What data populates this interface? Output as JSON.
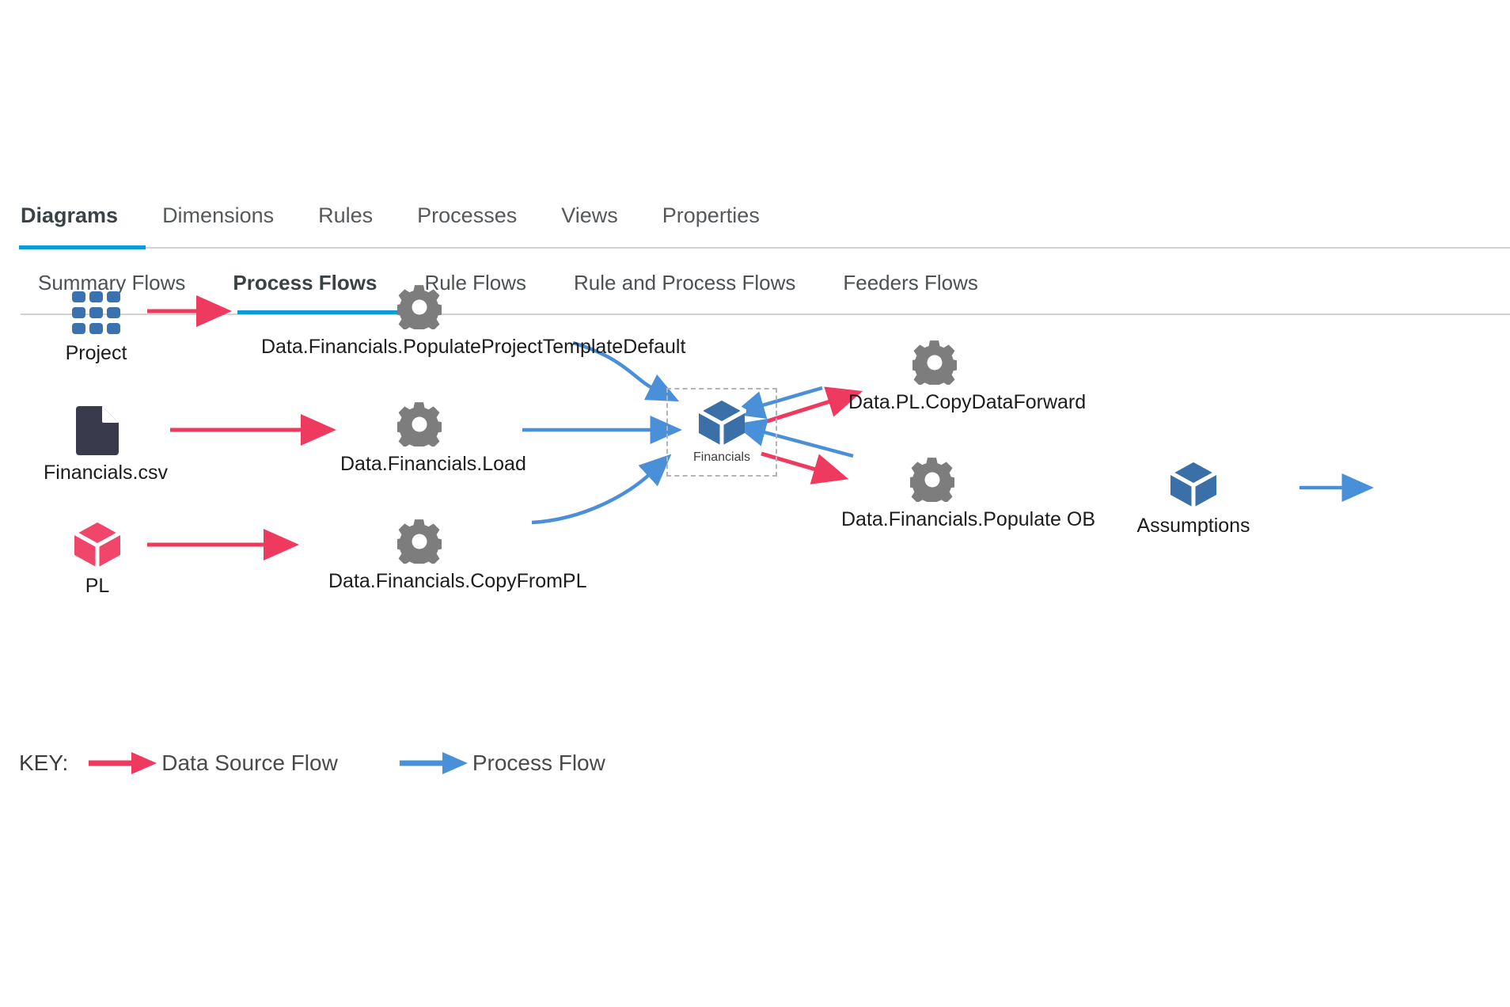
{
  "primary_tabs": [
    {
      "label": "Diagrams",
      "active": true
    },
    {
      "label": "Dimensions",
      "active": false
    },
    {
      "label": "Rules",
      "active": false
    },
    {
      "label": "Processes",
      "active": false
    },
    {
      "label": "Views",
      "active": false
    },
    {
      "label": "Properties",
      "active": false
    }
  ],
  "secondary_tabs": [
    {
      "label": "Summary Flows",
      "active": false
    },
    {
      "label": "Process Flows",
      "active": true
    },
    {
      "label": "Rule Flows",
      "active": false
    },
    {
      "label": "Rule and Process Flows",
      "active": false
    },
    {
      "label": "Feeders Flows",
      "active": false
    }
  ],
  "diagram": {
    "nodes": {
      "project": {
        "label": "Project",
        "icon": "grid-cube-icon"
      },
      "financials_csv": {
        "label": "Financials.csv",
        "icon": "file-icon"
      },
      "pl": {
        "label": "PL",
        "icon": "cube-icon"
      },
      "populate_project_template_default": {
        "label": "Data.Financials.PopulateProjectTemplateDefault",
        "icon": "gear-icon"
      },
      "financials_load": {
        "label": "Data.Financials.Load",
        "icon": "gear-icon"
      },
      "financials_copyfrompl": {
        "label": "Data.Financials.CopyFromPL",
        "icon": "gear-icon"
      },
      "financials_cube": {
        "label": "Financials",
        "icon": "cube-icon"
      },
      "pl_copydataforward": {
        "label": "Data.PL.CopyDataForward",
        "icon": "gear-icon"
      },
      "financials_populate_ob": {
        "label": "Data.Financials.Populate OB",
        "icon": "gear-icon"
      },
      "assumptions": {
        "label": "Assumptions",
        "icon": "cube-icon"
      }
    }
  },
  "key": {
    "label": "KEY:",
    "items": [
      {
        "text": "Data Source Flow",
        "color": "#ee3a5f",
        "arrow": "data-source-arrow"
      },
      {
        "text": "Process Flow",
        "color": "#4a90d9",
        "arrow": "process-arrow"
      }
    ]
  },
  "colors": {
    "accent_blue": "#0d9bd8",
    "flow_red": "#ee3a5f",
    "flow_blue": "#4a90d9",
    "cube_blue": "#3b6fa8",
    "cube_red": "#f0466a",
    "gear_gray": "#7d7d7d",
    "file_navy": "#3a3a4d",
    "grid_blue": "#3a72b0"
  }
}
